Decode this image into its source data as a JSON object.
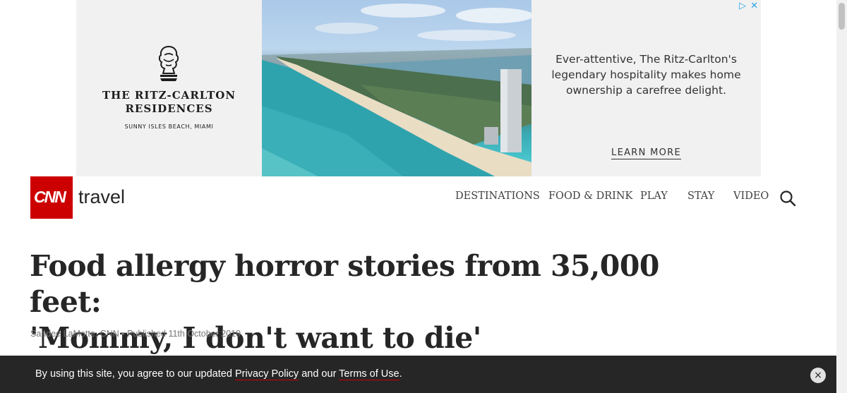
{
  "ad": {
    "brand_line1": "THE RITZ-CARLTON",
    "brand_line2": "RESIDENCES",
    "brand_location": "SUNNY ISLES BEACH, MIAMI",
    "tagline_line1": "Ever-attentive, The Ritz-Carlton's",
    "tagline_line2": "legendary hospitality makes home",
    "tagline_line3": "ownership a carefree delight.",
    "cta": "LEARN MORE",
    "adchoices_icon": "adchoices-play-icon",
    "close_glyph": "✕",
    "adchoices_glyph": "▷"
  },
  "header": {
    "logo_text": "CNN",
    "section": "travel",
    "nav": [
      "DESTINATIONS",
      "FOOD & DRINK",
      "PLAY",
      "STAY",
      "VIDEO"
    ],
    "search_icon": "search-icon"
  },
  "article": {
    "headline_line1": "Food allergy horror stories from 35,000 feet:",
    "headline_line2": "'Mommy, I don't want to die'",
    "byline": "Sandee LaMotte, CNN • Published 11th October 2019"
  },
  "consent": {
    "prefix": "By using this site, you agree to our updated ",
    "privacy_link": "Privacy Policy",
    "middle": " and our ",
    "terms_link": "Terms of Use",
    "suffix": ".",
    "close_glyph": "×"
  },
  "colors": {
    "brand_red": "#cc0000",
    "consent_bg": "#262626",
    "adchoices_blue": "#2aa3e6"
  }
}
